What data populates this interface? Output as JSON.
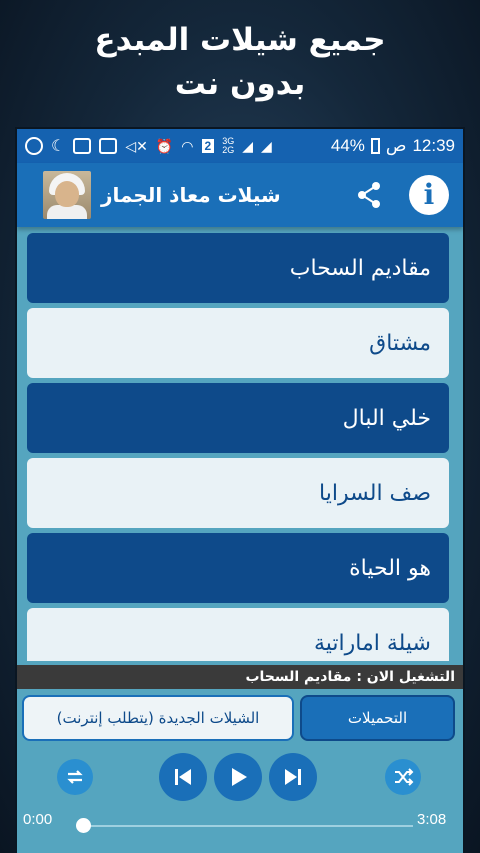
{
  "promo": {
    "line1": "جميع شيلات المبدع",
    "line2": "بدون نت"
  },
  "statusbar": {
    "time": "12:39",
    "ampm": "ص",
    "battery": "44%",
    "network_badge": "2",
    "net_top": "3G",
    "net_bottom": "2G"
  },
  "appbar": {
    "title": "شيلات معاذ الجماز",
    "share_icon": "share-icon",
    "info_icon": "info-icon",
    "info_glyph": "i"
  },
  "list": {
    "items": [
      {
        "label": "مقاديم السحاب",
        "style": "dark"
      },
      {
        "label": "مشتاق",
        "style": "light"
      },
      {
        "label": "خلي البال",
        "style": "dark"
      },
      {
        "label": "صف السرايا",
        "style": "light"
      },
      {
        "label": "هو الحياة",
        "style": "dark"
      },
      {
        "label": "شيلة اماراتية",
        "style": "light"
      }
    ]
  },
  "now_playing": {
    "text": "التشغيل الان : مقاديم السحاب"
  },
  "player": {
    "tab_downloads": "التحميلات",
    "tab_new": "الشيلات الجديدة (يتطلب إنترنت)",
    "time_elapsed": "0:00",
    "time_total": "3:08",
    "progress": 0.0
  },
  "colors": {
    "accent": "#1a6fb8",
    "dark_item": "#0e4a8a",
    "light_item": "#e9f2f6",
    "panel": "#55a5bf"
  }
}
